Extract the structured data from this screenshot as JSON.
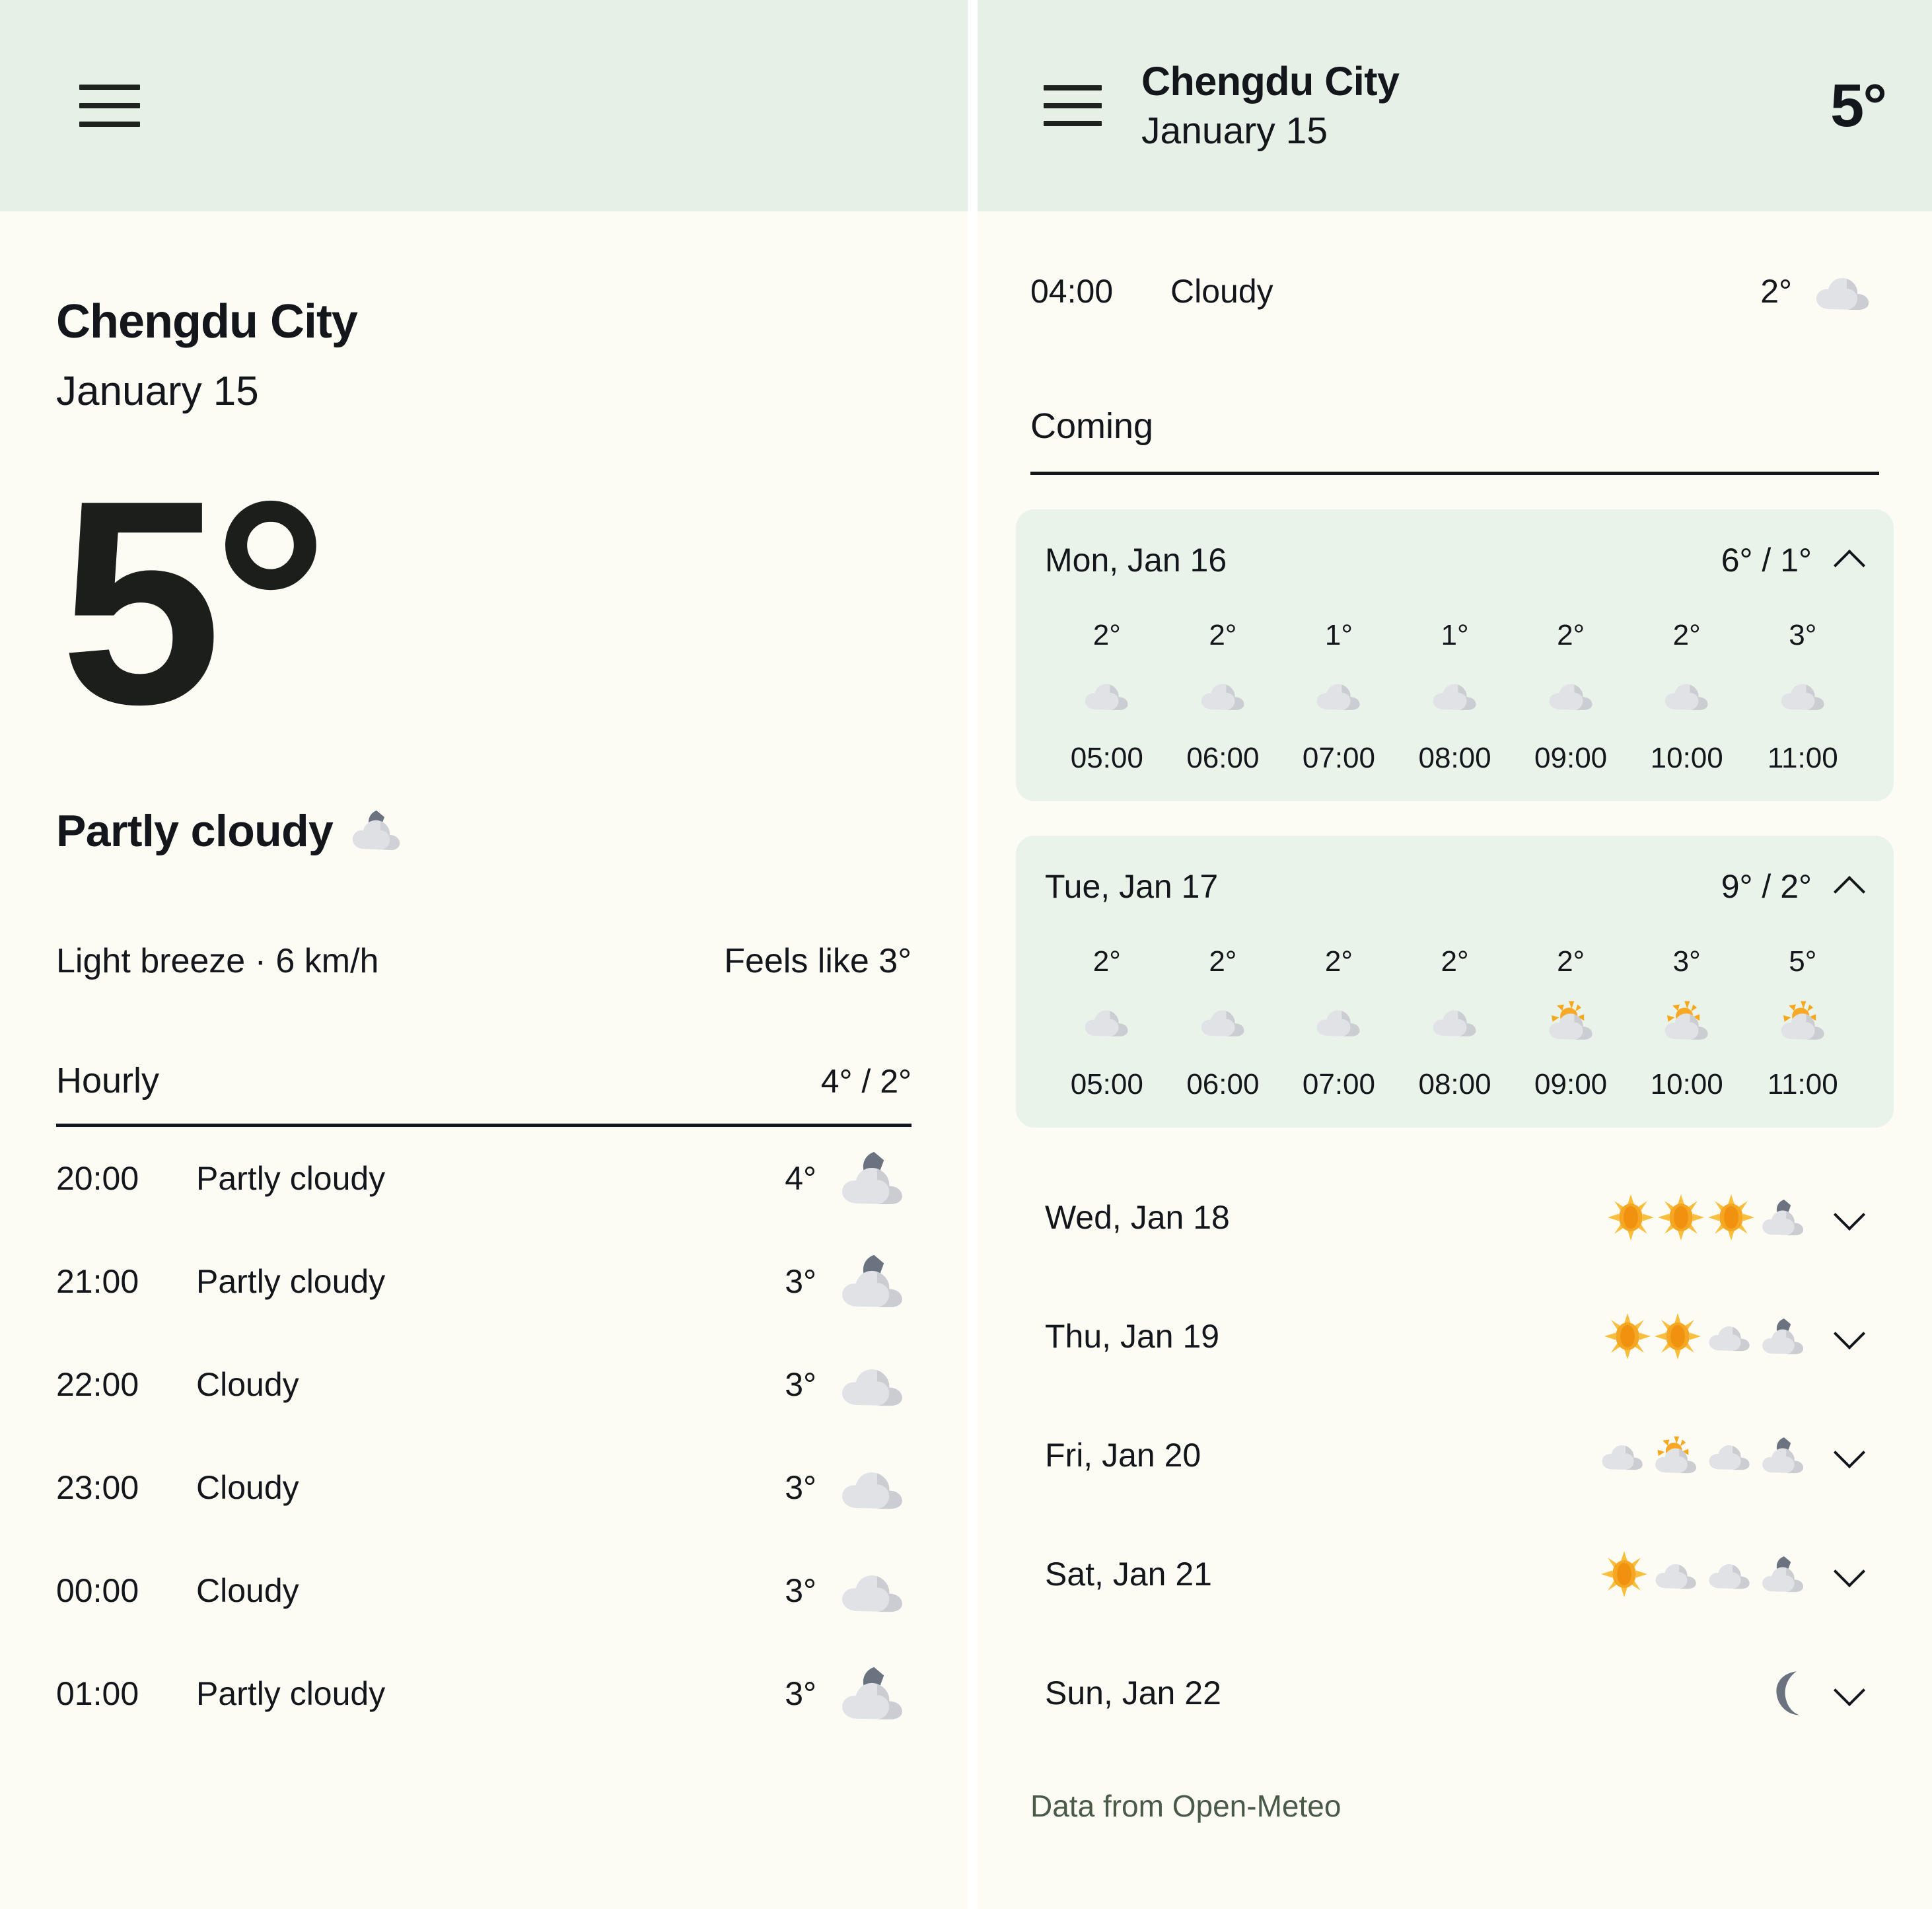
{
  "colors": {
    "header_bg": "#e6f0e6",
    "page_bg": "#fcfcf5",
    "card_bg": "#eaf3ea",
    "text": "#13161a",
    "cloud": "#dcdde1",
    "sun": "#f5a623",
    "moon": "#6b7280"
  },
  "left_panel": {
    "menu_icon": "hamburger-menu-icon",
    "city": "Chengdu City",
    "date": "January 15",
    "current_temp": "5°",
    "condition": "Partly cloudy",
    "condition_icon": "moon-behind-cloud-icon",
    "wind": "Light breeze · 6 km/h",
    "feels_like": "Feels like 3°",
    "hourly_title": "Hourly",
    "hourly_range": "4° / 2°",
    "hourly": [
      {
        "time": "20:00",
        "desc": "Partly cloudy",
        "temp": "4°",
        "icon": "moon-behind-cloud-icon"
      },
      {
        "time": "21:00",
        "desc": "Partly cloudy",
        "temp": "3°",
        "icon": "moon-behind-cloud-icon"
      },
      {
        "time": "22:00",
        "desc": "Cloudy",
        "temp": "3°",
        "icon": "cloud-icon"
      },
      {
        "time": "23:00",
        "desc": "Cloudy",
        "temp": "3°",
        "icon": "cloud-icon"
      },
      {
        "time": "00:00",
        "desc": "Cloudy",
        "temp": "3°",
        "icon": "cloud-icon"
      },
      {
        "time": "01:00",
        "desc": "Partly cloudy",
        "temp": "3°",
        "icon": "moon-behind-cloud-icon"
      }
    ]
  },
  "right_panel": {
    "menu_icon": "hamburger-menu-icon",
    "city": "Chengdu City",
    "date": "January 15",
    "current_temp": "5°",
    "top_hour": {
      "time": "04:00",
      "desc": "Cloudy",
      "temp": "2°",
      "icon": "cloud-icon"
    },
    "coming_title": "Coming",
    "expanded_days": [
      {
        "name": "Mon, Jan 16",
        "range": "6° / 1°",
        "chevron": "chevron-up-icon",
        "hours": [
          {
            "time": "05:00",
            "temp": "2°",
            "icon": "cloud-icon"
          },
          {
            "time": "06:00",
            "temp": "2°",
            "icon": "cloud-icon"
          },
          {
            "time": "07:00",
            "temp": "1°",
            "icon": "cloud-icon"
          },
          {
            "time": "08:00",
            "temp": "1°",
            "icon": "cloud-icon"
          },
          {
            "time": "09:00",
            "temp": "2°",
            "icon": "cloud-icon"
          },
          {
            "time": "10:00",
            "temp": "2°",
            "icon": "cloud-icon"
          },
          {
            "time": "11:00",
            "temp": "3°",
            "icon": "cloud-icon"
          }
        ]
      },
      {
        "name": "Tue, Jan 17",
        "range": "9° / 2°",
        "chevron": "chevron-up-icon",
        "hours": [
          {
            "time": "05:00",
            "temp": "2°",
            "icon": "cloud-icon"
          },
          {
            "time": "06:00",
            "temp": "2°",
            "icon": "cloud-icon"
          },
          {
            "time": "07:00",
            "temp": "2°",
            "icon": "cloud-icon"
          },
          {
            "time": "08:00",
            "temp": "2°",
            "icon": "cloud-icon"
          },
          {
            "time": "09:00",
            "temp": "2°",
            "icon": "sun-behind-cloud-icon"
          },
          {
            "time": "10:00",
            "temp": "3°",
            "icon": "sun-behind-cloud-icon"
          },
          {
            "time": "11:00",
            "temp": "5°",
            "icon": "sun-behind-cloud-icon"
          }
        ]
      }
    ],
    "collapsed_days": [
      {
        "name": "Wed, Jan 18",
        "chevron": "chevron-down-icon",
        "icons": [
          "sun-icon",
          "sun-icon",
          "sun-icon",
          "moon-behind-cloud-icon"
        ]
      },
      {
        "name": "Thu, Jan 19",
        "chevron": "chevron-down-icon",
        "icons": [
          "sun-icon",
          "sun-icon",
          "cloud-icon",
          "moon-behind-cloud-icon"
        ]
      },
      {
        "name": "Fri, Jan 20",
        "chevron": "chevron-down-icon",
        "icons": [
          "cloud-icon",
          "sun-behind-cloud-icon",
          "cloud-icon",
          "moon-behind-cloud-icon"
        ]
      },
      {
        "name": "Sat, Jan 21",
        "chevron": "chevron-down-icon",
        "icons": [
          "sun-icon",
          "cloud-icon",
          "cloud-icon",
          "moon-behind-cloud-icon"
        ]
      },
      {
        "name": "Sun, Jan 22",
        "chevron": "chevron-down-icon",
        "icons": [
          "moon-icon"
        ]
      }
    ],
    "footer": "Data from Open-Meteo"
  }
}
